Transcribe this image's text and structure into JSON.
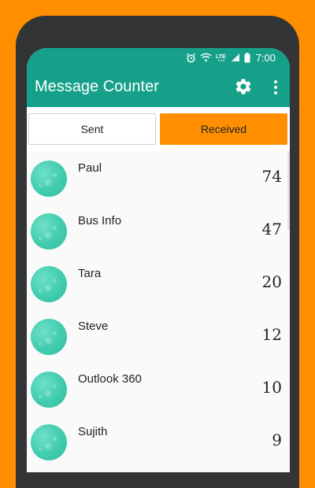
{
  "status_bar": {
    "time": "7:00",
    "network": "LTE",
    "icons": [
      "alarm-icon",
      "wifi-icon",
      "lte-icon",
      "signal-icon",
      "battery-icon"
    ]
  },
  "app_bar": {
    "title": "Message Counter",
    "settings_icon": "gear-icon",
    "overflow_icon": "more-vert-icon",
    "color": "#16A08A"
  },
  "tabs": [
    {
      "label": "Sent",
      "selected": false
    },
    {
      "label": "Received",
      "selected": true,
      "color": "#FF8F00"
    }
  ],
  "contacts": [
    {
      "name": "Paul",
      "count": "74"
    },
    {
      "name": "Bus Info",
      "count": "47"
    },
    {
      "name": "Tara",
      "count": "20"
    },
    {
      "name": "Steve",
      "count": "12"
    },
    {
      "name": "Outlook 360",
      "count": "10"
    },
    {
      "name": "Sujith",
      "count": "9"
    }
  ],
  "colors": {
    "background": "#FF8F00",
    "avatar": "#41CCAD"
  }
}
